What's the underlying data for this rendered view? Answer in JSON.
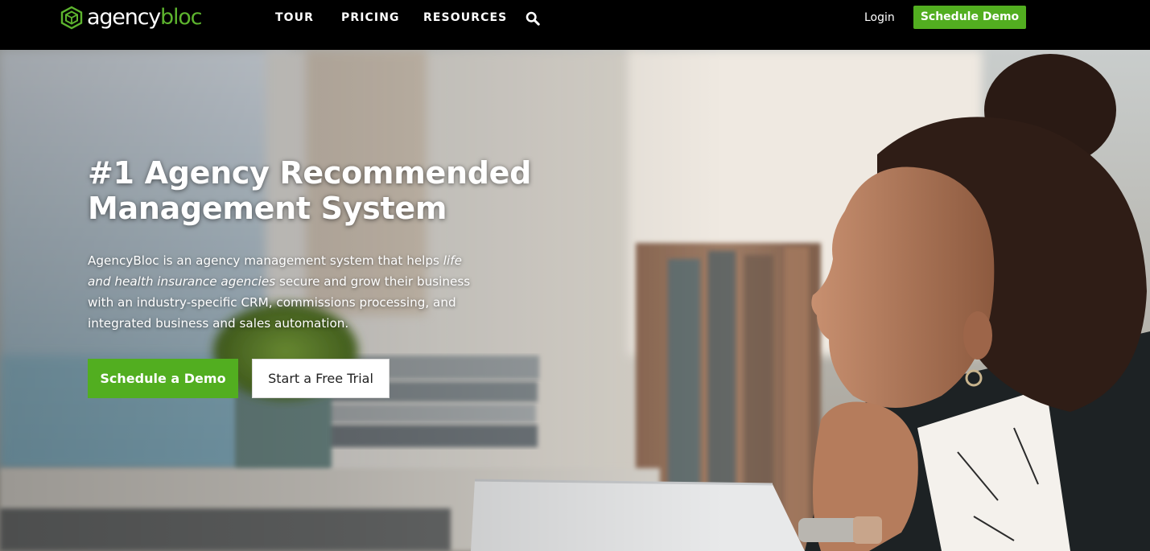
{
  "brand": {
    "logo_part1": "agency",
    "logo_part2": "bloc",
    "accent_color": "#52ae20"
  },
  "nav": {
    "links": [
      "TOUR",
      "PRICING",
      "RESOURCES"
    ],
    "search_icon": "search-icon",
    "login_label": "Login",
    "cta_label": "Schedule Demo"
  },
  "hero": {
    "title_line1": "#1 Agency Recommended",
    "title_line2": "Management System",
    "body_line1_text": "AgencyBloc is an agency management system that helps ",
    "body_line1_em": "life",
    "body_line2_em": "and health insurance agencies",
    "body_line2_text": " secure and grow their business",
    "body_line3": "with an industry-specific CRM, commissions processing, and",
    "body_line4": "integrated business and sales automation.",
    "primary_button": "Schedule a Demo",
    "secondary_button": "Start a Free Trial",
    "image_subject": "woman resting chin on hand looking out of office window"
  }
}
